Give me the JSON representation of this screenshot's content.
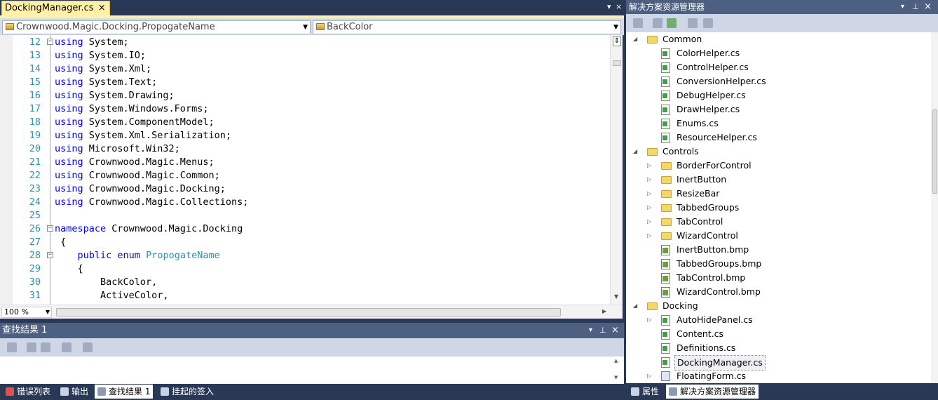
{
  "editor": {
    "tab_label": "DockingManager.cs",
    "tab_close": "×",
    "type_combo": "Crownwood.Magic.Docking.PropogateName",
    "member_combo": "BackColor",
    "zoom": "100 %",
    "lines": [
      {
        "n": "12",
        "fold": "−",
        "parts": [
          [
            "kw",
            "using"
          ],
          [
            "t",
            " System;"
          ]
        ]
      },
      {
        "n": "13",
        "parts": [
          [
            "kw",
            "using"
          ],
          [
            "t",
            " System.IO;"
          ]
        ]
      },
      {
        "n": "14",
        "parts": [
          [
            "kw",
            "using"
          ],
          [
            "t",
            " System.Xml;"
          ]
        ]
      },
      {
        "n": "15",
        "parts": [
          [
            "kw",
            "using"
          ],
          [
            "t",
            " System.Text;"
          ]
        ]
      },
      {
        "n": "16",
        "parts": [
          [
            "kw",
            "using"
          ],
          [
            "t",
            " System.Drawing;"
          ]
        ]
      },
      {
        "n": "17",
        "parts": [
          [
            "kw",
            "using"
          ],
          [
            "t",
            " System.Windows.Forms;"
          ]
        ]
      },
      {
        "n": "18",
        "parts": [
          [
            "kw",
            "using"
          ],
          [
            "t",
            " System.ComponentModel;"
          ]
        ]
      },
      {
        "n": "19",
        "parts": [
          [
            "kw",
            "using"
          ],
          [
            "t",
            " System.Xml.Serialization;"
          ]
        ]
      },
      {
        "n": "20",
        "parts": [
          [
            "kw",
            "using"
          ],
          [
            "t",
            " Microsoft.Win32;"
          ]
        ]
      },
      {
        "n": "21",
        "parts": [
          [
            "kw",
            "using"
          ],
          [
            "t",
            " Crownwood.Magic.Menus;"
          ]
        ]
      },
      {
        "n": "22",
        "parts": [
          [
            "kw",
            "using"
          ],
          [
            "t",
            " Crownwood.Magic.Common;"
          ]
        ]
      },
      {
        "n": "23",
        "parts": [
          [
            "kw",
            "using"
          ],
          [
            "t",
            " Crownwood.Magic.Docking;"
          ]
        ]
      },
      {
        "n": "24",
        "parts": [
          [
            "kw",
            "using"
          ],
          [
            "t",
            " Crownwood.Magic.Collections;"
          ]
        ]
      },
      {
        "n": "25",
        "parts": []
      },
      {
        "n": "26",
        "fold": "−",
        "parts": [
          [
            "kw",
            "namespace"
          ],
          [
            "t",
            " Crownwood.Magic.Docking"
          ]
        ]
      },
      {
        "n": "27",
        "parts": [
          [
            "t",
            " {"
          ]
        ]
      },
      {
        "n": "28",
        "fold": "−",
        "parts": [
          [
            "t",
            "    "
          ],
          [
            "kw",
            "public enum"
          ],
          [
            "t",
            " "
          ],
          [
            "ty",
            "PropogateName"
          ]
        ]
      },
      {
        "n": "29",
        "parts": [
          [
            "t",
            "    {"
          ]
        ]
      },
      {
        "n": "30",
        "parts": [
          [
            "t",
            "        BackColor,"
          ]
        ]
      },
      {
        "n": "31",
        "parts": [
          [
            "t",
            "        ActiveColor,"
          ]
        ]
      }
    ]
  },
  "find_results": {
    "title": "查找结果 1"
  },
  "bottom_tabs": [
    "错误列表",
    "输出",
    "查找结果 1",
    "挂起的签入"
  ],
  "solution_explorer": {
    "title": "解决方案资源管理器",
    "tree": [
      {
        "label": "Common",
        "type": "folder-open",
        "level": 0
      },
      {
        "label": "ColorHelper.cs",
        "type": "cs",
        "level": 1
      },
      {
        "label": "ControlHelper.cs",
        "type": "cs",
        "level": 1
      },
      {
        "label": "ConversionHelper.cs",
        "type": "cs",
        "level": 1
      },
      {
        "label": "DebugHelper.cs",
        "type": "cs",
        "level": 1
      },
      {
        "label": "DrawHelper.cs",
        "type": "cs",
        "level": 1
      },
      {
        "label": "Enums.cs",
        "type": "cs",
        "level": 1
      },
      {
        "label": "ResourceHelper.cs",
        "type": "cs",
        "level": 1
      },
      {
        "label": "Controls",
        "type": "folder-open",
        "level": 0
      },
      {
        "label": "BorderForControl",
        "type": "folder",
        "level": 1
      },
      {
        "label": "InertButton",
        "type": "folder",
        "level": 1
      },
      {
        "label": "ResizeBar",
        "type": "folder",
        "level": 1
      },
      {
        "label": "TabbedGroups",
        "type": "folder",
        "level": 1
      },
      {
        "label": "TabControl",
        "type": "folder",
        "level": 1
      },
      {
        "label": "WizardControl",
        "type": "folder",
        "level": 1
      },
      {
        "label": "InertButton.bmp",
        "type": "bmp",
        "level": 1
      },
      {
        "label": "TabbedGroups.bmp",
        "type": "bmp",
        "level": 1
      },
      {
        "label": "TabControl.bmp",
        "type": "bmp",
        "level": 1
      },
      {
        "label": "WizardControl.bmp",
        "type": "bmp",
        "level": 1
      },
      {
        "label": "Docking",
        "type": "folder-open",
        "level": 0
      },
      {
        "label": "AutoHidePanel.cs",
        "type": "cs-expand",
        "level": 1
      },
      {
        "label": "Content.cs",
        "type": "cs",
        "level": 1
      },
      {
        "label": "Definitions.cs",
        "type": "cs",
        "level": 1
      },
      {
        "label": "DockingManager.cs",
        "type": "cs",
        "level": 1,
        "selected": true
      },
      {
        "label": "FloatingForm.cs",
        "type": "form-expand",
        "level": 1
      }
    ],
    "bottom_tabs": [
      "属性",
      "解决方案资源管理器"
    ]
  },
  "colors": {
    "chrome": "#293955",
    "active_tab": "#fff1a8",
    "keyword": "#0000ff",
    "type": "#2b91af"
  }
}
